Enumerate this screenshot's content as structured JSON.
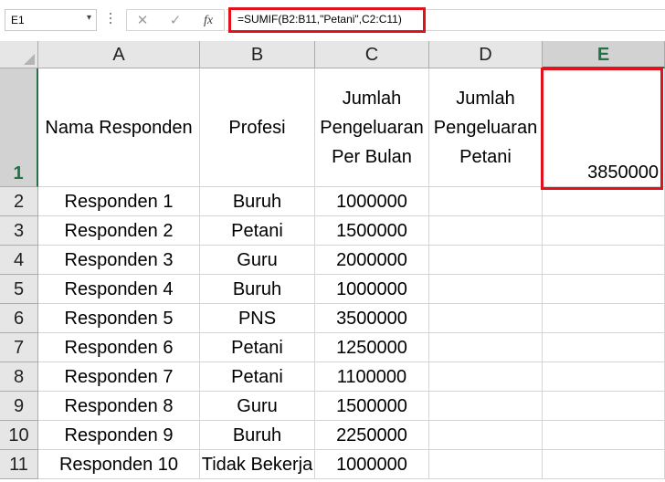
{
  "formula_bar": {
    "name_box": "E1",
    "name_box_arrow": "▾",
    "cancel_symbol": "✕",
    "enter_symbol": "✓",
    "fx_label": "fx",
    "formula": "=SUMIF(B2:B11,\"Petani\",C2:C11)"
  },
  "columns": [
    "A",
    "B",
    "C",
    "D",
    "E"
  ],
  "selected_cell": "E1",
  "header_row": {
    "row_number": "1",
    "A": "Nama Responden",
    "B": "Profesi",
    "C": [
      "Jumlah",
      "Pengeluaran",
      "Per Bulan"
    ],
    "D": [
      "Jumlah",
      "Pengeluaran",
      "Petani"
    ],
    "E": "3850000"
  },
  "rows": [
    {
      "row": "2",
      "nama": "Responden 1",
      "profesi": "Buruh",
      "pengeluaran": "1000000"
    },
    {
      "row": "3",
      "nama": "Responden 2",
      "profesi": "Petani",
      "pengeluaran": "1500000"
    },
    {
      "row": "4",
      "nama": "Responden 3",
      "profesi": "Guru",
      "pengeluaran": "2000000"
    },
    {
      "row": "5",
      "nama": "Responden 4",
      "profesi": "Buruh",
      "pengeluaran": "1000000"
    },
    {
      "row": "6",
      "nama": "Responden 5",
      "profesi": "PNS",
      "pengeluaran": "3500000"
    },
    {
      "row": "7",
      "nama": "Responden 6",
      "profesi": "Petani",
      "pengeluaran": "1250000"
    },
    {
      "row": "8",
      "nama": "Responden 7",
      "profesi": "Petani",
      "pengeluaran": "1100000"
    },
    {
      "row": "9",
      "nama": "Responden 8",
      "profesi": "Guru",
      "pengeluaran": "1500000"
    },
    {
      "row": "10",
      "nama": "Responden 9",
      "profesi": "Buruh",
      "pengeluaran": "2250000"
    },
    {
      "row": "11",
      "nama": "Responden 10",
      "profesi": "Tidak Bekerja",
      "pengeluaran": "1000000"
    }
  ],
  "colors": {
    "highlight_red": "#e0121b",
    "excel_green": "#217346"
  }
}
